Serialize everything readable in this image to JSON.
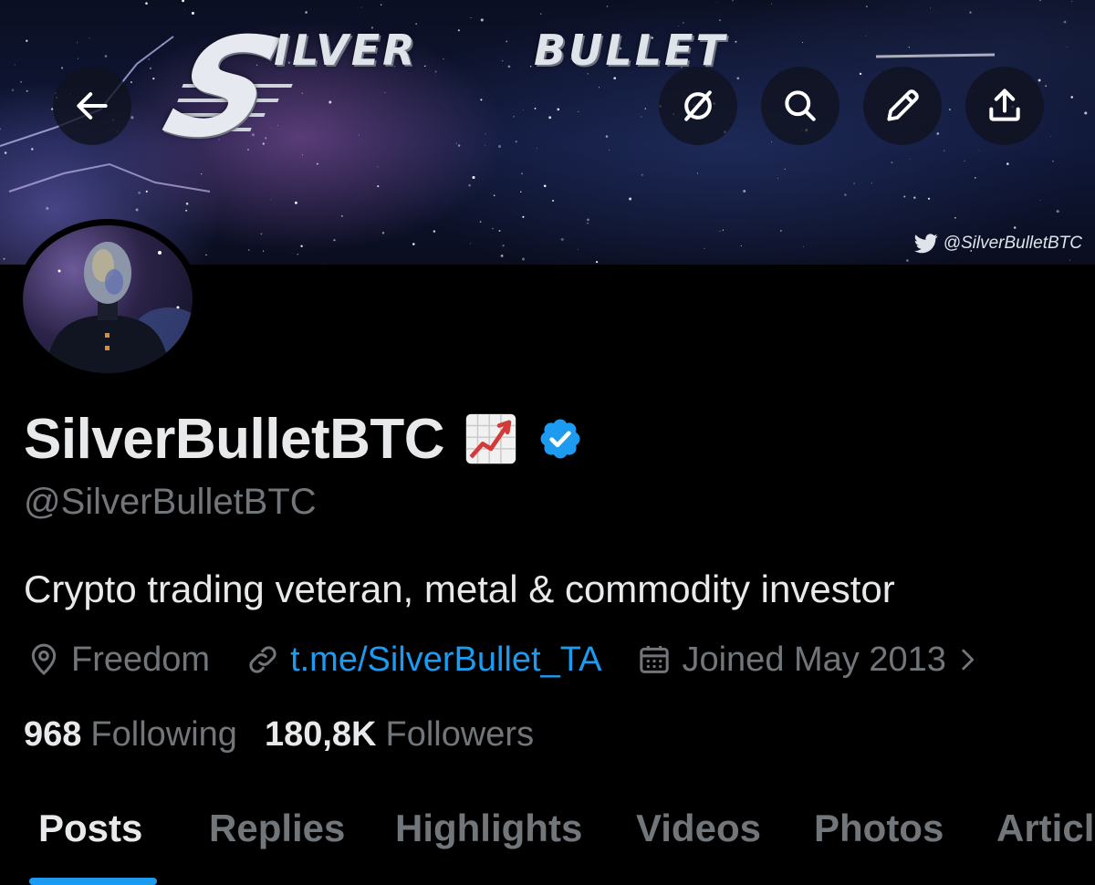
{
  "banner": {
    "logo_s": "S",
    "logo_word1": "ILVER",
    "logo_word2": "BULLET",
    "watermark": "@SilverBulletBTC"
  },
  "header": {
    "back_icon": "arrow-left-icon",
    "actions": [
      "grok-icon",
      "search-icon",
      "edit-icon",
      "share-icon"
    ]
  },
  "profile": {
    "display_name": "SilverBulletBTC",
    "name_emoji": "chart-increasing-emoji",
    "verified_color": "#1d9bf0",
    "handle": "@SilverBulletBTC",
    "bio": "Crypto trading veteran, metal & commodity investor",
    "location": "Freedom",
    "website": "t.me/SilverBullet_TA",
    "joined": "Joined May 2013",
    "following_count": "968",
    "following_label": "Following",
    "followers_count": "180,8K",
    "followers_label": "Followers"
  },
  "tabs": [
    {
      "label": "Posts",
      "active": true
    },
    {
      "label": "Replies"
    },
    {
      "label": "Highlights"
    },
    {
      "label": "Videos"
    },
    {
      "label": "Photos"
    },
    {
      "label": "Articles"
    }
  ],
  "colors": {
    "background": "#000000",
    "accent": "#1d9bf0",
    "text_primary": "#e7e9ea",
    "text_secondary": "#71767b"
  }
}
